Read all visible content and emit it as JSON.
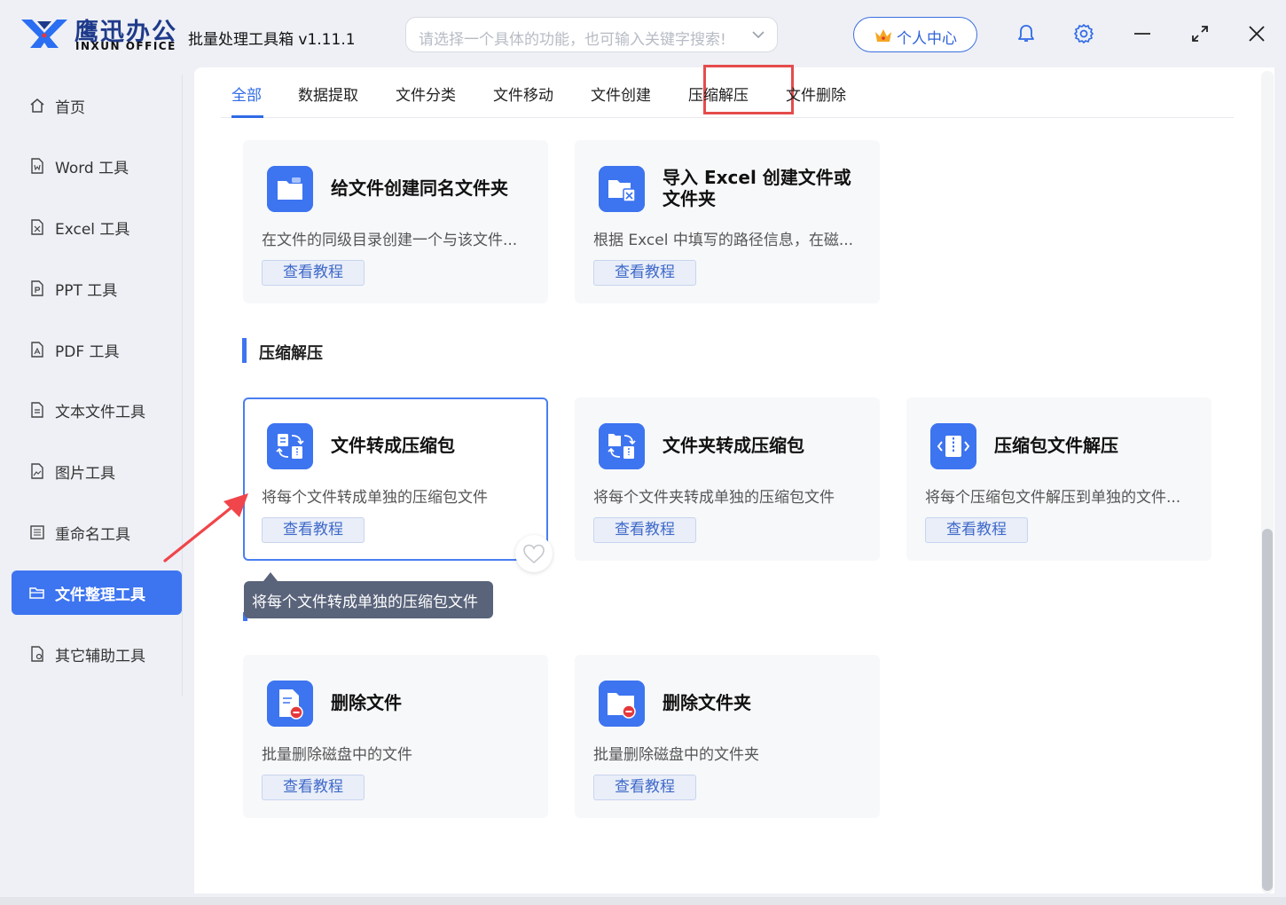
{
  "app": {
    "brand_cn": "鹰迅办公",
    "brand_en": "INXUN OFFICE",
    "title_version": "批量处理工具箱 v1.11.1"
  },
  "search": {
    "placeholder": "请选择一个具体的功能，也可输入关键字搜索!"
  },
  "header": {
    "user_center": "个人中心"
  },
  "sidebar": {
    "items": [
      {
        "label": "首页",
        "icon": "home-icon"
      },
      {
        "label": "Word 工具",
        "icon": "word-file-icon"
      },
      {
        "label": "Excel 工具",
        "icon": "excel-file-icon"
      },
      {
        "label": "PPT 工具",
        "icon": "ppt-file-icon"
      },
      {
        "label": "PDF 工具",
        "icon": "pdf-file-icon"
      },
      {
        "label": "文本文件工具",
        "icon": "text-file-icon"
      },
      {
        "label": "图片工具",
        "icon": "image-file-icon"
      },
      {
        "label": "重命名工具",
        "icon": "rename-icon"
      },
      {
        "label": "文件整理工具",
        "icon": "folder-icon",
        "active": true
      },
      {
        "label": "其它辅助工具",
        "icon": "other-tools-icon"
      }
    ]
  },
  "tabs": [
    {
      "label": "全部",
      "active": true
    },
    {
      "label": "数据提取"
    },
    {
      "label": "文件分类"
    },
    {
      "label": "文件移动"
    },
    {
      "label": "文件创建"
    },
    {
      "label": "压缩解压",
      "highlighted": true
    },
    {
      "label": "文件删除"
    }
  ],
  "cards_create": [
    {
      "title": "给文件创建同名文件夹",
      "desc": "在文件的同级目录创建一个与该文件...",
      "button": "查看教程",
      "icon": "folder-create-icon"
    },
    {
      "title": "导入 Excel 创建文件或文件夹",
      "desc": "根据 Excel 中填写的路径信息，在磁...",
      "button": "查看教程",
      "icon": "excel-folder-icon"
    }
  ],
  "section_compress": {
    "title": "压缩解压"
  },
  "cards_compress": [
    {
      "title": "文件转成压缩包",
      "desc": "将每个文件转成单独的压缩包文件",
      "button": "查看教程",
      "icon": "file-to-zip-icon"
    },
    {
      "title": "文件夹转成压缩包",
      "desc": "将每个文件夹转成单独的压缩包文件",
      "button": "查看教程",
      "icon": "folder-to-zip-icon"
    },
    {
      "title": "压缩包文件解压",
      "desc": "将每个压缩包文件解压到单独的文件...",
      "button": "查看教程",
      "icon": "unzip-icon"
    }
  ],
  "tooltip": {
    "text": "将每个文件转成单独的压缩包文件"
  },
  "cards_delete": [
    {
      "title": "删除文件",
      "desc": "批量删除磁盘中的文件",
      "button": "查看教程",
      "icon": "delete-file-icon"
    },
    {
      "title": "删除文件夹",
      "desc": "批量删除磁盘中的文件夹",
      "button": "查看教程",
      "icon": "delete-folder-icon"
    }
  ],
  "colors": {
    "accent": "#3d74f0",
    "highlight_box": "#e54c4c",
    "annotation_arrow": "#f0454a"
  }
}
